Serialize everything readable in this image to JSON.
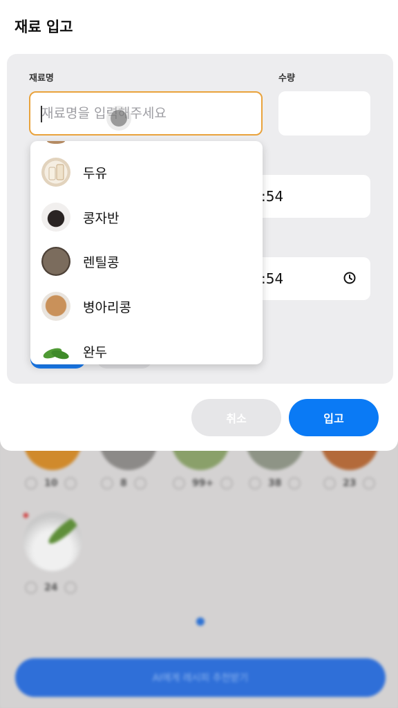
{
  "modal": {
    "title": "재료 입고",
    "name_label": "재료명",
    "name_placeholder": "재료명을 입력해주세요",
    "quantity_label": "수량",
    "time_fields": [
      {
        "value": ":54",
        "has_clock_icon": false
      },
      {
        "value": ":54",
        "has_clock_icon": true
      }
    ],
    "dropdown": {
      "items": [
        {
          "label": "두유",
          "icon": "soy-milk-icon"
        },
        {
          "label": "콩자반",
          "icon": "braised-black-beans-icon"
        },
        {
          "label": "렌틸콩",
          "icon": "lentils-icon"
        },
        {
          "label": "병아리콩",
          "icon": "chickpeas-icon"
        },
        {
          "label": "완두",
          "icon": "peas-icon"
        }
      ]
    },
    "buttons": {
      "cancel": "취소",
      "confirm": "입고"
    }
  },
  "background": {
    "steppers": [
      "10",
      "8",
      "99+",
      "38",
      "23"
    ],
    "last_item_count": "24",
    "cta_label": "AI에게 레시피 추천받기"
  },
  "colors": {
    "accent_blue": "#0a7af5",
    "focus_orange": "#e9a23b",
    "form_bg": "#ededef"
  }
}
